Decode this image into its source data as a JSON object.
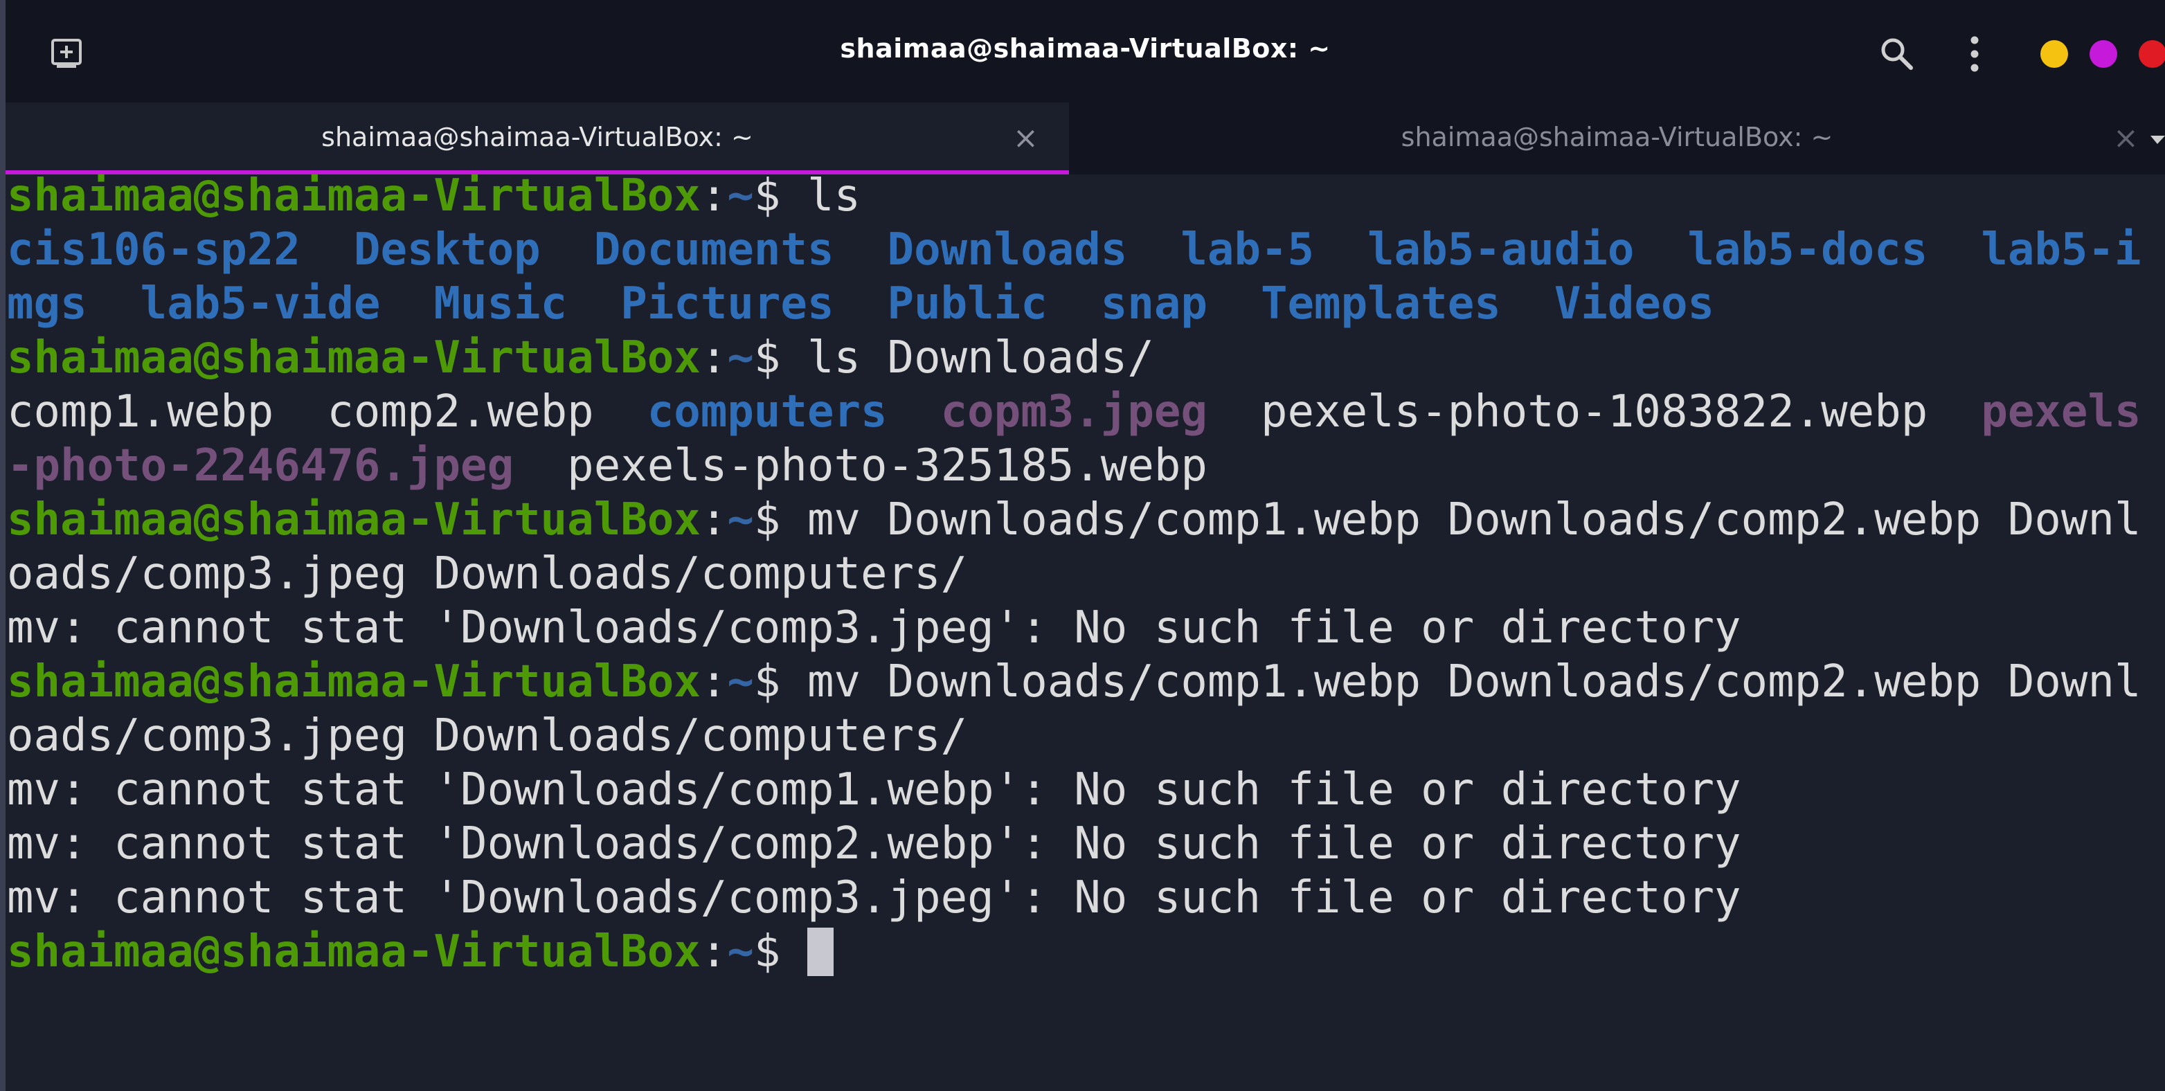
{
  "window": {
    "title": "shaimaa@shaimaa-VirtualBox: ~",
    "controls": [
      "minimize",
      "maximize",
      "close"
    ],
    "colors": {
      "minimize": "#f5c211",
      "maximize": "#c61adb",
      "close": "#e01b24"
    }
  },
  "header": {
    "new_tab_icon": "new-tab-icon",
    "search_icon": "search-icon",
    "menu_icon": "kebab-menu-icon"
  },
  "tabs": [
    {
      "label": "shaimaa@shaimaa-VirtualBox: ~",
      "active": true,
      "close": "×"
    },
    {
      "label": "shaimaa@shaimaa-VirtualBox: ~",
      "active": false,
      "close": "×"
    }
  ],
  "terminal": {
    "prompt_user": "shaimaa@shaimaa-VirtualBox",
    "prompt_sep": ":",
    "prompt_path": "~",
    "prompt_dollar": "$ ",
    "commands": {
      "c1": "ls",
      "c2": "ls Downloads/",
      "c3a": "mv Downloads/comp1.webp Downloads/comp2.webp Downl",
      "c3b": "oads/comp3.jpeg Downloads/computers/",
      "c4a": "mv Downloads/comp1.webp Downloads/comp2.webp Downl",
      "c4b": "oads/comp3.jpeg Downloads/computers/"
    },
    "ls_home": {
      "row1": [
        "cis106-sp22",
        "Desktop",
        "Documents",
        "Downloads",
        "lab-5",
        "lab5-audio",
        "lab5-docs",
        "lab5-i"
      ],
      "row2": [
        "mgs",
        "lab5-vide",
        "Music",
        "Pictures",
        "Public",
        "snap",
        "Templates",
        "Videos"
      ]
    },
    "ls_downloads": {
      "row1": {
        "f1": "comp1.webp",
        "f2": "comp2.webp",
        "f3": "computers",
        "f4": "copm3.jpeg",
        "f5": "pexels-photo-1083822.webp",
        "f6": "pexels"
      },
      "row2": {
        "f1": "-photo-2246476.jpeg",
        "f2": "pexels-photo-325185.webp"
      }
    },
    "errors": {
      "e1": "mv: cannot stat 'Downloads/comp3.jpeg': No such file or directory",
      "e2": "mv: cannot stat 'Downloads/comp1.webp': No such file or directory",
      "e3": "mv: cannot stat 'Downloads/comp2.webp': No such file or directory",
      "e4": "mv: cannot stat 'Downloads/comp3.jpeg': No such file or directory"
    },
    "colors": {
      "prompt_user": "#4e9a06",
      "directory": "#2f6eb8",
      "image_file": "#75507b",
      "text": "#dcdcdc",
      "background": "#1b1e2b"
    }
  }
}
